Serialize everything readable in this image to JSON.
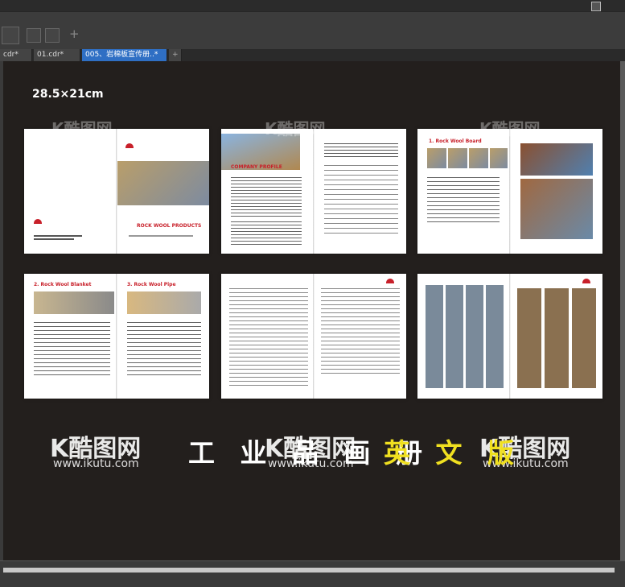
{
  "tabs": [
    {
      "label": "cdr*"
    },
    {
      "label": "01.cdr*"
    },
    {
      "label": "005、岩棉板宣传册..*"
    },
    {
      "label": "+"
    }
  ],
  "toolbar": {
    "add_label": "+"
  },
  "canvas": {
    "size_label": "28.5×21cm",
    "title_white": "工 业 品 画 册",
    "title_yellow": "英 文 版",
    "watermark_logo": "K酷图网",
    "watermark_url": "www.ikutu.com"
  },
  "spreads": [
    {
      "text": "ROCK WOOL PRODUCTS"
    },
    {
      "text": "COMPANY PROFILE"
    },
    {
      "text": "1. Rock Wool Board"
    },
    {
      "text": "2. Rock Wool Blanket",
      "text2": "3. Rock Wool Pipe"
    },
    {
      "text": ""
    },
    {
      "text": ""
    }
  ],
  "colors": {
    "accent": "#c8202a",
    "title_yellow": "#f0e020",
    "canvas_bg": "#231f1d",
    "active_tab": "#2f6fc4"
  }
}
